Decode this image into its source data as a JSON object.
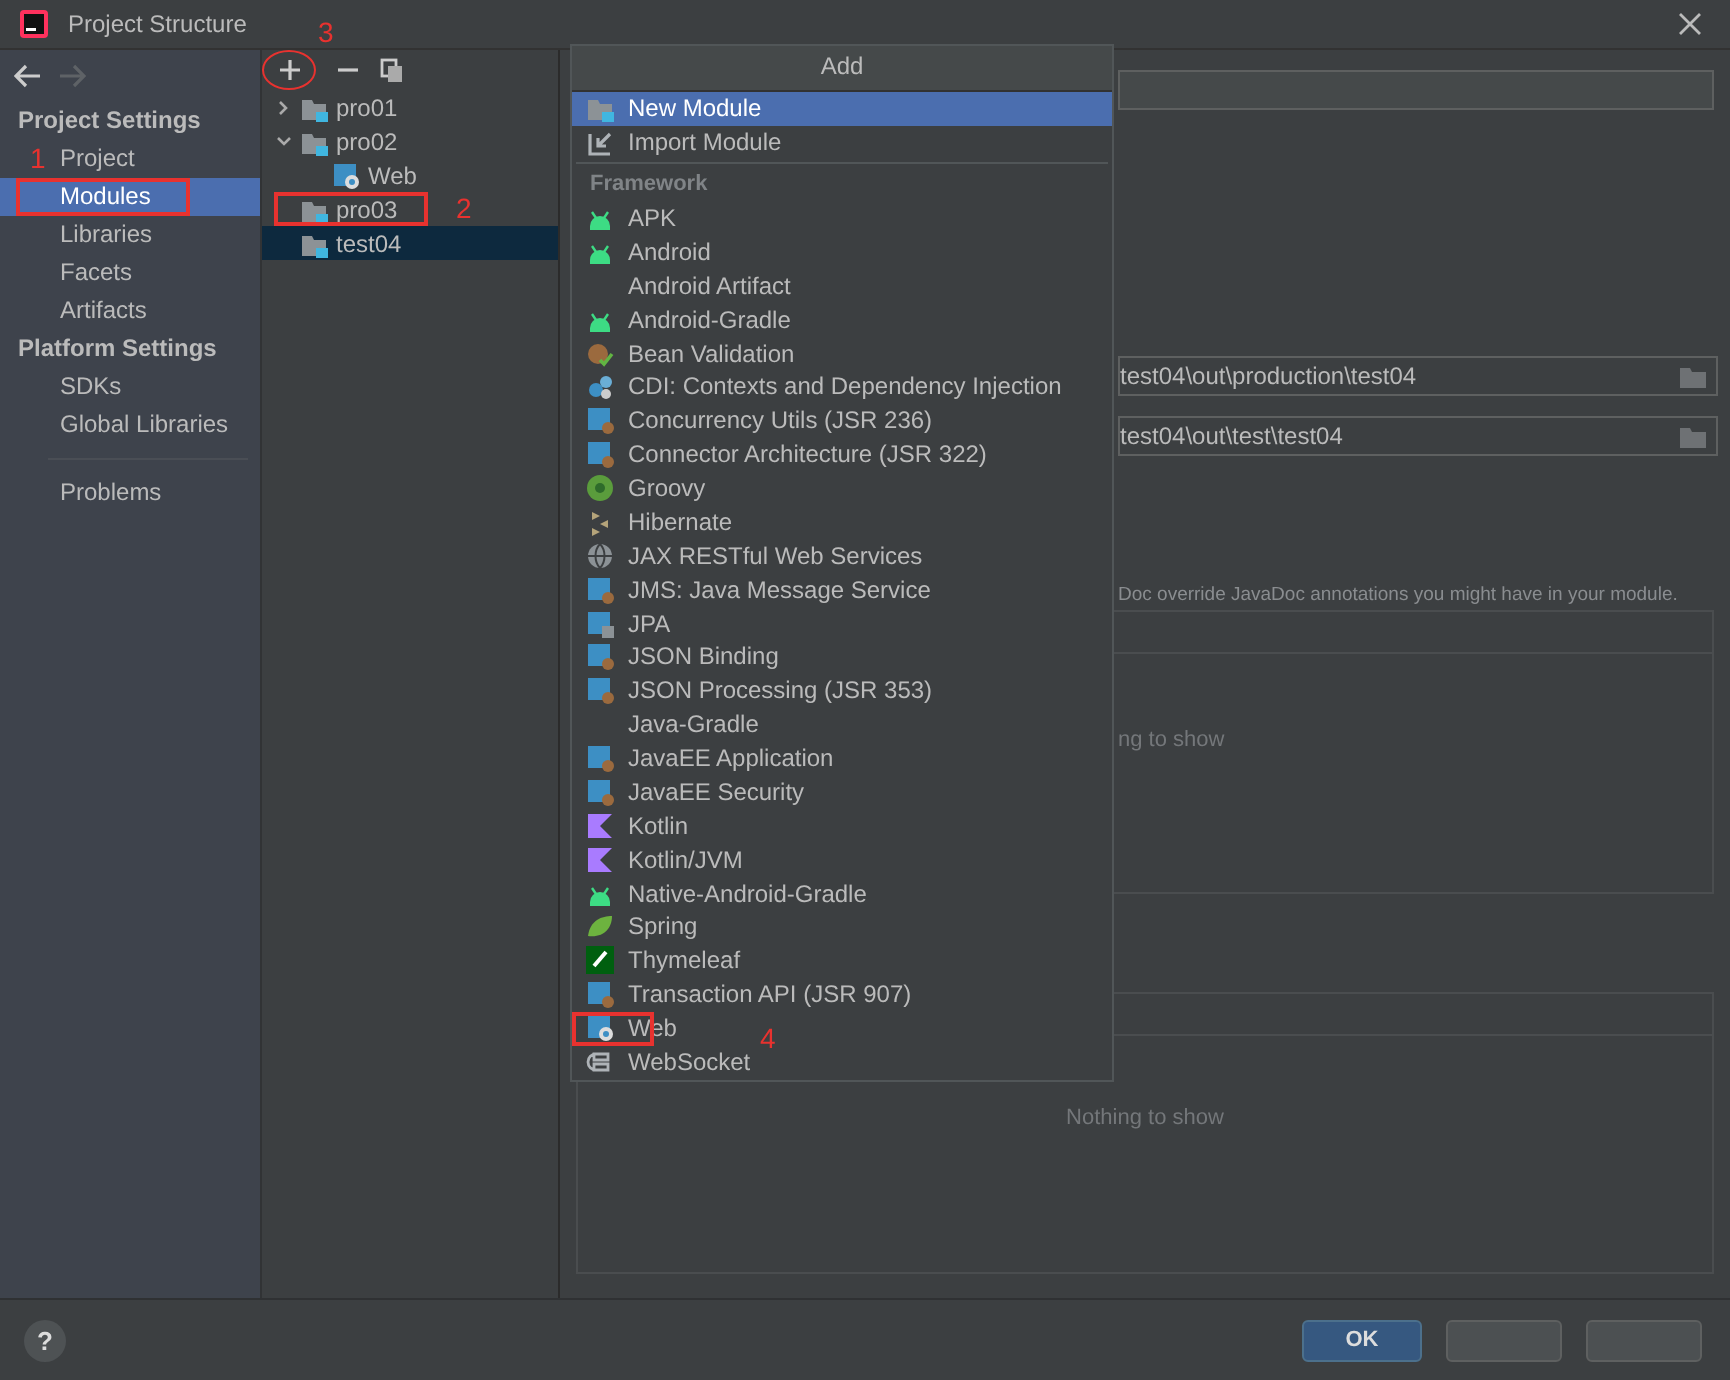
{
  "window": {
    "title": "Project Structure"
  },
  "sidebar": {
    "sections": [
      {
        "heading": "Project Settings",
        "items": [
          {
            "label": "Project",
            "selected": false
          },
          {
            "label": "Modules",
            "selected": true
          },
          {
            "label": "Libraries",
            "selected": false
          },
          {
            "label": "Facets",
            "selected": false
          },
          {
            "label": "Artifacts",
            "selected": false
          }
        ]
      },
      {
        "heading": "Platform Settings",
        "items": [
          {
            "label": "SDKs",
            "selected": false
          },
          {
            "label": "Global Libraries",
            "selected": false
          }
        ]
      },
      {
        "items": [
          {
            "label": "Problems",
            "selected": false
          }
        ]
      }
    ]
  },
  "tree": {
    "items": [
      {
        "label": "pro01",
        "expanded": false,
        "selected": false
      },
      {
        "label": "pro02",
        "expanded": true,
        "selected": false,
        "children": [
          {
            "label": "Web",
            "selected": false
          }
        ]
      },
      {
        "label": "pro03",
        "selected": false
      },
      {
        "label": "test04",
        "selected": true
      }
    ]
  },
  "popup": {
    "title": "Add",
    "items": [
      {
        "kind": "action",
        "label": "New Module",
        "selected": true
      },
      {
        "kind": "action",
        "label": "Import Module",
        "selected": false
      },
      {
        "kind": "header",
        "label": "Framework"
      },
      {
        "kind": "item",
        "label": "APK",
        "selected": false
      },
      {
        "kind": "item",
        "label": "Android",
        "selected": false
      },
      {
        "kind": "item",
        "label": "Android Artifact",
        "selected": false
      },
      {
        "kind": "item",
        "label": "Android-Gradle",
        "selected": false
      },
      {
        "kind": "item",
        "label": "Bean Validation",
        "selected": false
      },
      {
        "kind": "item",
        "label": "CDI: Contexts and Dependency Injection",
        "selected": false
      },
      {
        "kind": "item",
        "label": "Concurrency Utils (JSR 236)",
        "selected": false
      },
      {
        "kind": "item",
        "label": "Connector Architecture (JSR 322)",
        "selected": false
      },
      {
        "kind": "item",
        "label": "Groovy",
        "selected": false
      },
      {
        "kind": "item",
        "label": "Hibernate",
        "selected": false
      },
      {
        "kind": "item",
        "label": "JAX RESTful Web Services",
        "selected": false
      },
      {
        "kind": "item",
        "label": "JMS: Java Message Service",
        "selected": false
      },
      {
        "kind": "item",
        "label": "JPA",
        "selected": false
      },
      {
        "kind": "item",
        "label": "JSON Binding",
        "selected": false
      },
      {
        "kind": "item",
        "label": "JSON Processing (JSR 353)",
        "selected": false
      },
      {
        "kind": "item",
        "label": "Java-Gradle",
        "selected": false
      },
      {
        "kind": "item",
        "label": "JavaEE Application",
        "selected": false
      },
      {
        "kind": "item",
        "label": "JavaEE Security",
        "selected": false
      },
      {
        "kind": "item",
        "label": "Kotlin",
        "selected": false
      },
      {
        "kind": "item",
        "label": "Kotlin/JVM",
        "selected": false
      },
      {
        "kind": "item",
        "label": "Native-Android-Gradle",
        "selected": false
      },
      {
        "kind": "item",
        "label": "Spring",
        "selected": false
      },
      {
        "kind": "item",
        "label": "Thymeleaf",
        "selected": false
      },
      {
        "kind": "item",
        "label": "Transaction API (JSR 907)",
        "selected": false
      },
      {
        "kind": "item",
        "label": "Web",
        "selected": false
      },
      {
        "kind": "item",
        "label": "WebSocket",
        "selected": false
      }
    ]
  },
  "content": {
    "output_path": "test04\\out\\production\\test04",
    "test_output_path": "test04\\out\\test\\test04",
    "javadoc_note": "Doc override JavaDoc annotations you might have in your module.",
    "panels": [
      {
        "empty_text": "ng to show"
      },
      {
        "empty_text": "Nothing to show"
      }
    ]
  },
  "footer": {
    "help": "?",
    "buttons": [
      "OK"
    ]
  },
  "annotations": [
    "1",
    "2",
    "3",
    "4"
  ]
}
